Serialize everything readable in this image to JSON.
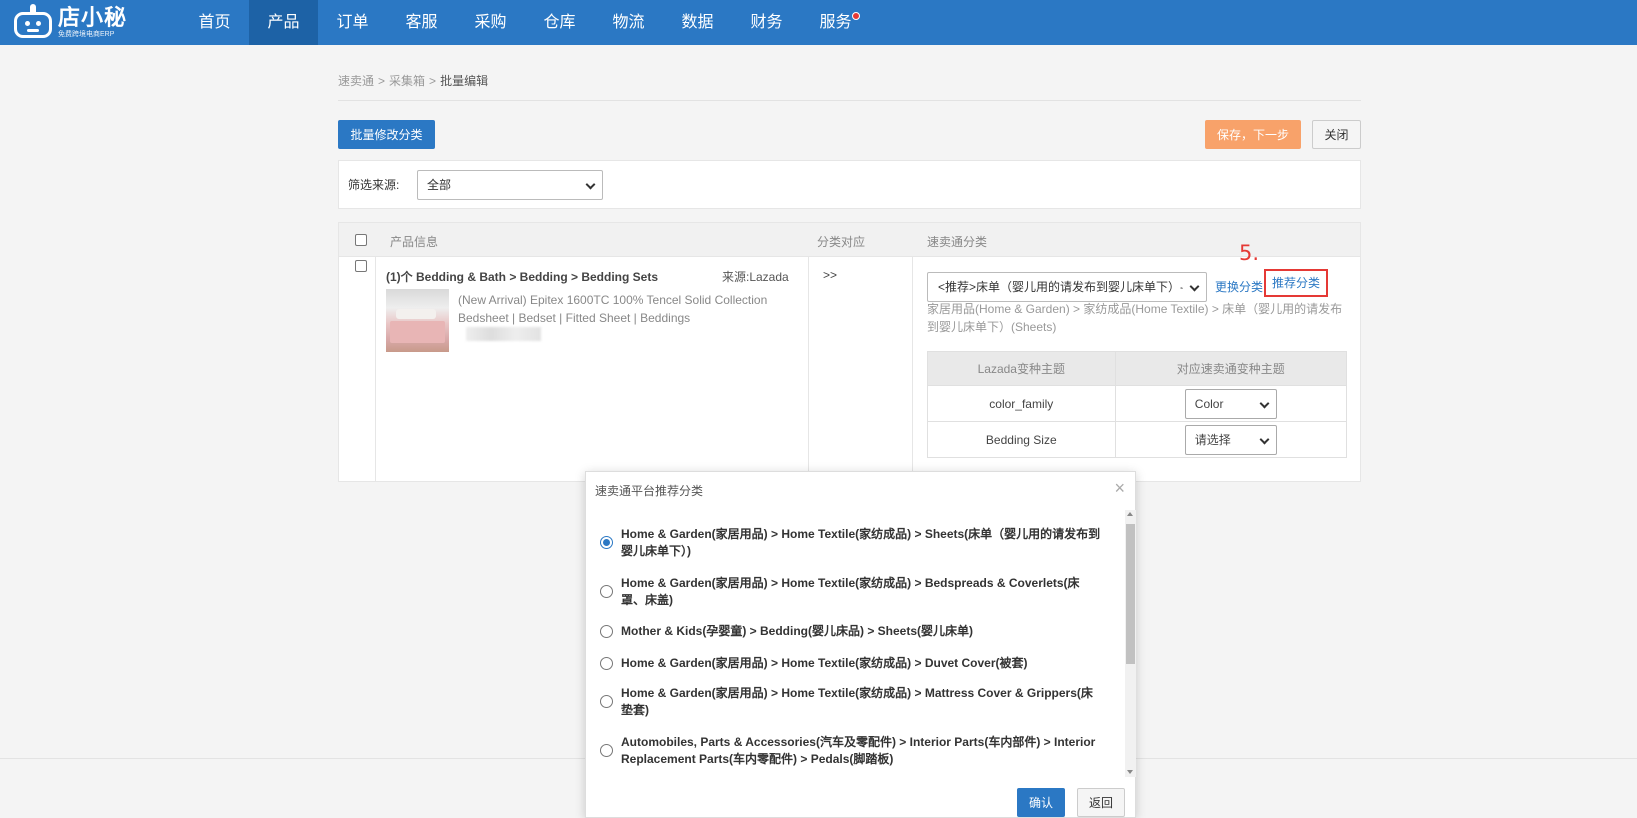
{
  "brand": {
    "name": "店小秘",
    "tagline": "免费跨境电商ERP"
  },
  "nav": {
    "items": [
      {
        "label": "首页"
      },
      {
        "label": "产品"
      },
      {
        "label": "订单"
      },
      {
        "label": "客服"
      },
      {
        "label": "采购"
      },
      {
        "label": "仓库"
      },
      {
        "label": "物流"
      },
      {
        "label": "数据"
      },
      {
        "label": "财务"
      },
      {
        "label": "服务"
      }
    ],
    "active": "产品"
  },
  "breadcrumb": [
    "速卖通",
    "采集箱",
    "批量编辑"
  ],
  "toolbar": {
    "batch_label": "批量修改分类",
    "save_label": "保存，下一步",
    "close_label": "关闭"
  },
  "filter": {
    "label": "筛选来源:",
    "value": "全部"
  },
  "table": {
    "headers": {
      "product": "产品信息",
      "mapping": "分类对应",
      "category": "速卖通分类"
    },
    "row": {
      "title": "(1)个 Bedding & Bath > Bedding > Bedding Sets",
      "source": "来源:Lazada",
      "description": "(New Arrival) Epitex 1600TC 100% Tencel Solid Collection Bedsheet | Bedset | Fitted Sheet | Beddings",
      "mapping": ">>",
      "category_select": "<推荐>床单（婴儿用的请发布到婴儿床单下）-",
      "change_link": "更换分类",
      "recommend_link": "推荐分类",
      "step_marker": "5.",
      "category_path": "家居用品(Home & Garden) > 家纺成品(Home Textile) > 床单（婴儿用的请发布到婴儿床单下）(Sheets)",
      "variant_headers": [
        "Lazada变种主题",
        "对应速卖通变种主题"
      ],
      "variants": [
        {
          "name": "color_family",
          "value": "Color"
        },
        {
          "name": "Bedding Size",
          "value": "请选择"
        }
      ]
    }
  },
  "modal": {
    "title": "速卖通平台推荐分类",
    "close": "×",
    "options": [
      {
        "text": "Home & Garden(家居用品) > Home Textile(家纺成品) > Sheets(床单（婴儿用的请发布到婴儿床单下）)",
        "selected": true
      },
      {
        "text": "Home & Garden(家居用品) > Home Textile(家纺成品) > Bedspreads & Coverlets(床罩、床盖)",
        "selected": false
      },
      {
        "text": "Mother & Kids(孕婴童) > Bedding(婴儿床品) > Sheets(婴儿床单)",
        "selected": false
      },
      {
        "text": "Home & Garden(家居用品) > Home Textile(家纺成品) > Duvet Cover(被套)",
        "selected": false
      },
      {
        "text": "Home & Garden(家居用品) > Home Textile(家纺成品) > Mattress Cover & Grippers(床垫套)",
        "selected": false
      },
      {
        "text": "Automobiles, Parts & Accessories(汽车及零配件) > Interior Parts(车内部件) > Interior Replacement Parts(车内零配件) > Pedals(脚踏板)",
        "selected": false
      }
    ],
    "confirm_label": "确认",
    "back_label": "返回"
  },
  "colors": {
    "primary": "#2b78c4",
    "save": "#f8a26a",
    "alert": "#e53935"
  }
}
